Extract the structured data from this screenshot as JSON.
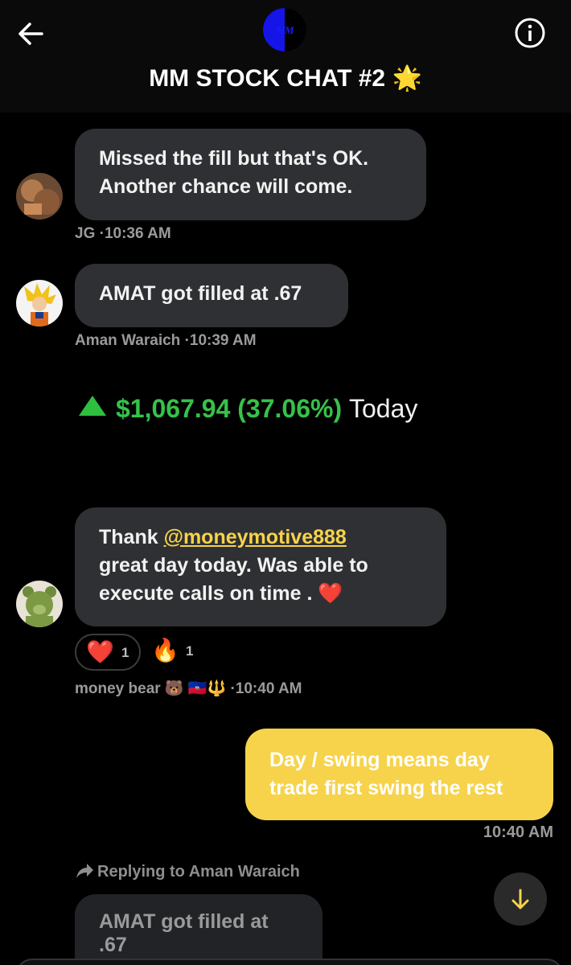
{
  "header": {
    "title": "MM STOCK CHAT #2",
    "title_emoji": "🌟",
    "logo_text": "MM",
    "back_icon": "arrow-left-icon",
    "info_icon": "info-circle-icon"
  },
  "messages": [
    {
      "author": "JG",
      "time": "·10:36 AM",
      "lines": [
        "Missed the fill but that's OK.",
        "Another chance will come."
      ]
    },
    {
      "author": "Aman Waraich",
      "time": "·10:39 AM",
      "lines": [
        "AMAT got filled at .67"
      ]
    },
    {
      "author": "money bear 🐻 🇭🇹🔱",
      "time": "·10:40 AM",
      "line1_prefix": "Thank ",
      "mention": "@moneymotive888",
      "line2": "great day today. Was able to",
      "line3": "execute calls on time .",
      "line3_emoji": "❤️",
      "reactions": [
        {
          "emoji": "❤️",
          "count": "1"
        },
        {
          "emoji": "🔥",
          "count": "1"
        }
      ]
    }
  ],
  "pnl": {
    "amount": "$1,067.94",
    "percent": "(37.06%)",
    "period": "Today"
  },
  "own_message": {
    "lines": [
      "Day / swing means day",
      "trade first swing the rest"
    ],
    "time": "10:40 AM"
  },
  "reply": {
    "label": "Replying to Aman Waraich",
    "quoted": "AMAT got filled at .67"
  },
  "colors": {
    "accent": "#f6d34b",
    "positive": "#36c24a",
    "bubble": "#2f3033",
    "background": "#000000"
  }
}
